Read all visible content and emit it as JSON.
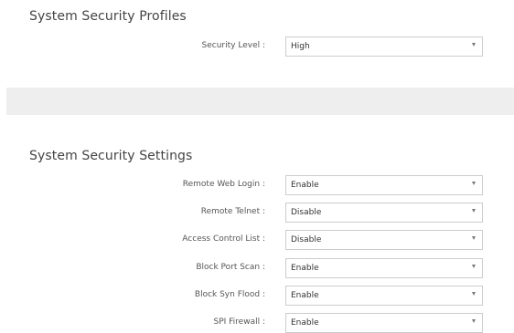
{
  "profiles": {
    "title": "System Security Profiles",
    "fields": [
      {
        "label": "Security Level :",
        "value": "High"
      }
    ]
  },
  "settings": {
    "title": "System Security Settings",
    "fields": [
      {
        "label": "Remote Web Login :",
        "value": "Enable"
      },
      {
        "label": "Remote Telnet :",
        "value": "Disable"
      },
      {
        "label": "Access Control List :",
        "value": "Disable"
      },
      {
        "label": "Block Port Scan :",
        "value": "Enable"
      },
      {
        "label": "Block Syn Flood :",
        "value": "Enable"
      },
      {
        "label": "SPI Firewall :",
        "value": "Enable"
      }
    ]
  },
  "icons": {
    "dropdown": "chevron-down-icon"
  }
}
